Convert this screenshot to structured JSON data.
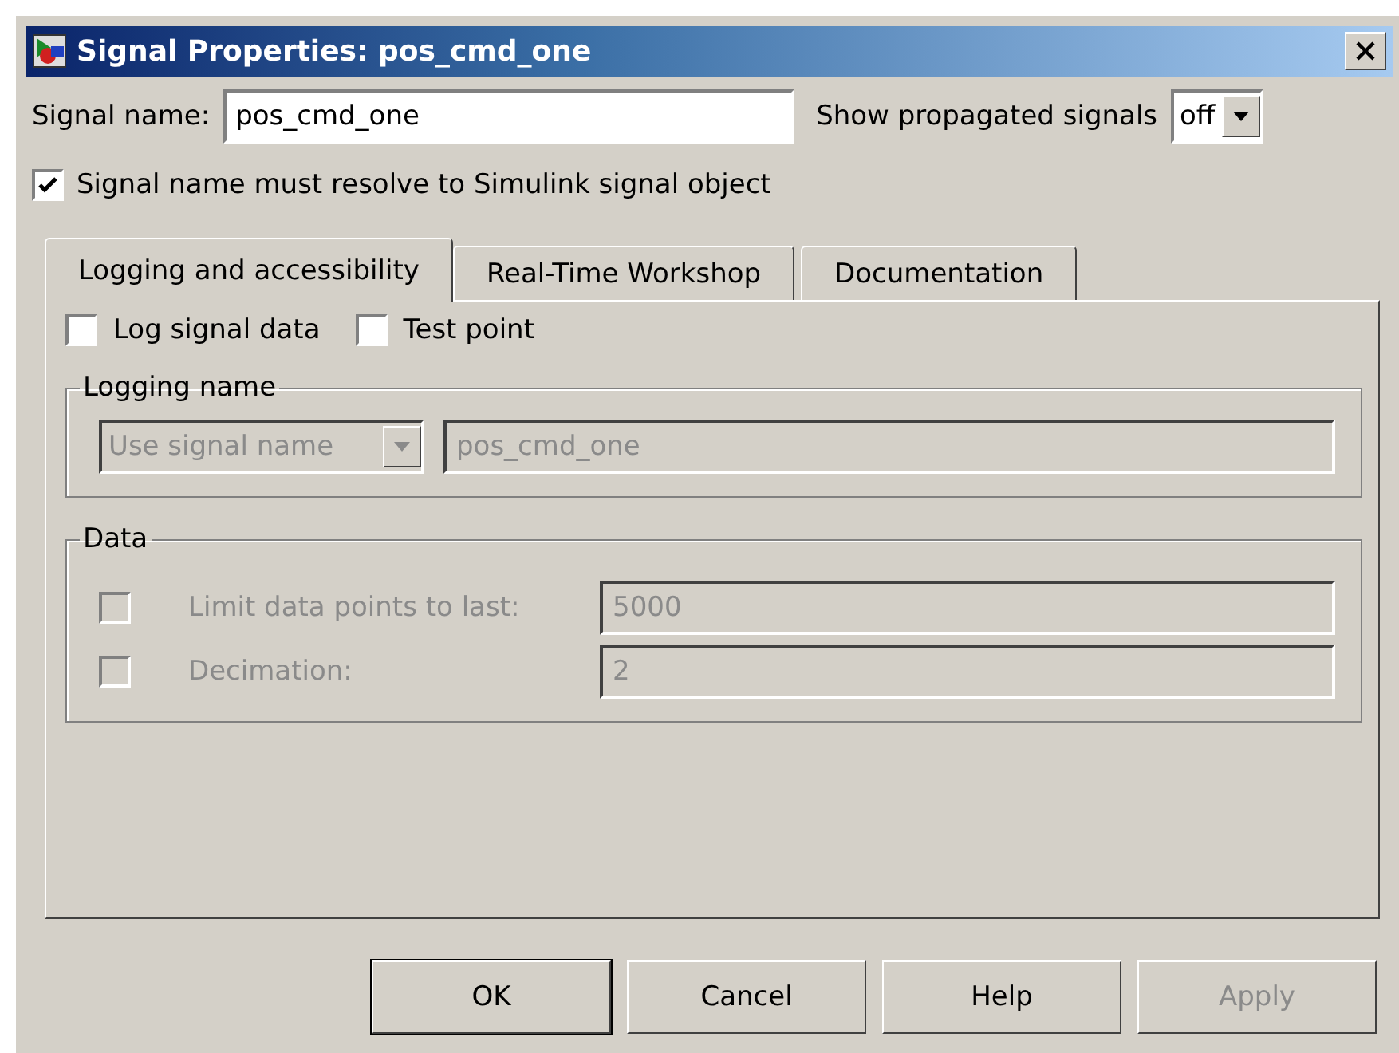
{
  "window": {
    "title": "Signal Properties: pos_cmd_one"
  },
  "signal_name": {
    "label": "Signal name:",
    "value": "pos_cmd_one"
  },
  "show_propagated": {
    "label": "Show propagated signals",
    "value": "off"
  },
  "resolve_checkbox": {
    "label": "Signal name must resolve to Simulink signal object",
    "checked": true
  },
  "tabs": [
    {
      "label": "Logging and accessibility",
      "selected": true
    },
    {
      "label": "Real-Time Workshop",
      "selected": false
    },
    {
      "label": "Documentation",
      "selected": false
    }
  ],
  "options": [
    {
      "label": "Log signal data",
      "checked": false
    },
    {
      "label": "Test point",
      "checked": false
    }
  ],
  "logging_name": {
    "title": "Logging name",
    "mode": {
      "value": "Use signal name",
      "disabled": true
    },
    "name_field": {
      "value": "pos_cmd_one",
      "disabled": true
    }
  },
  "data": {
    "title": "Data",
    "rows": [
      {
        "label": "Limit data points to last:",
        "value": "5000",
        "checked": false,
        "disabled": true
      },
      {
        "label": "Decimation:",
        "value": "2",
        "checked": false,
        "disabled": true
      }
    ]
  },
  "buttons": [
    {
      "label": "OK",
      "disabled": false,
      "default": true
    },
    {
      "label": "Cancel",
      "disabled": false,
      "default": false
    },
    {
      "label": "Help",
      "disabled": false,
      "default": false
    },
    {
      "label": "Apply",
      "disabled": true,
      "default": false
    }
  ]
}
